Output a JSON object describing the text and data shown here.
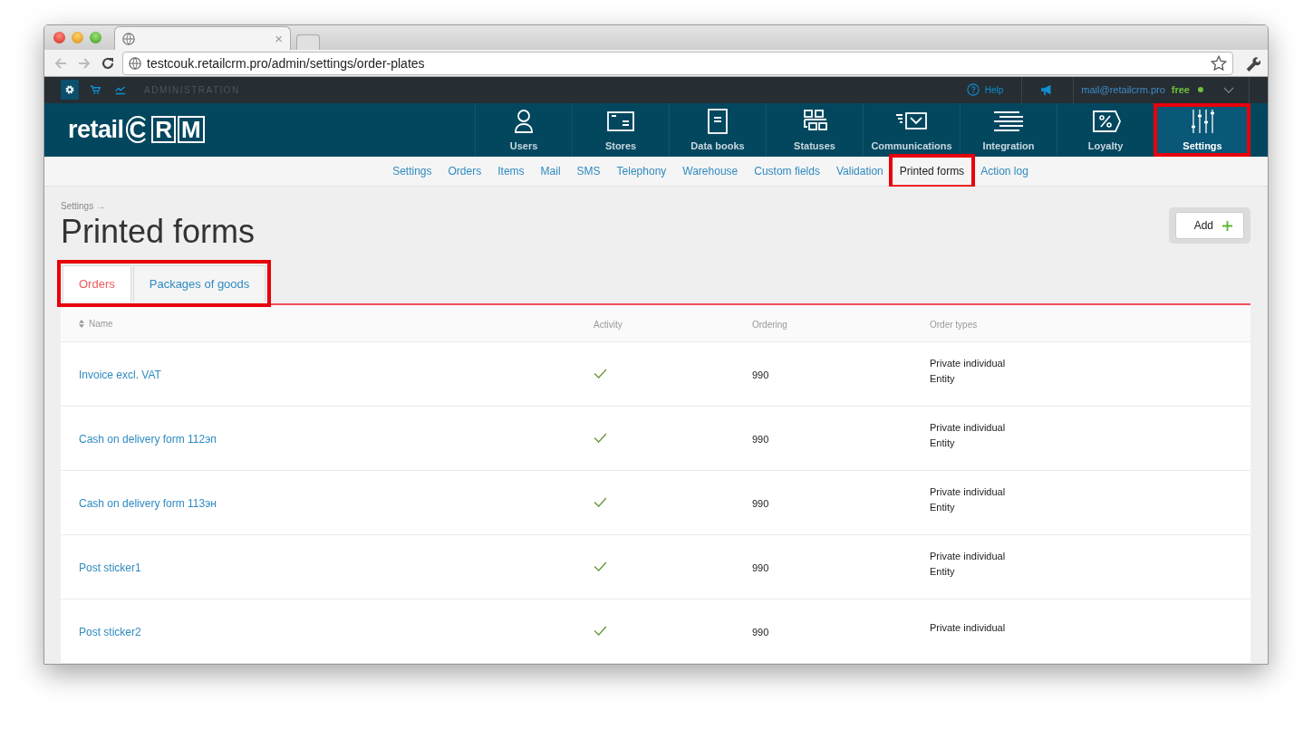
{
  "browser": {
    "tab_close": "×",
    "url": "testcouk.retailcrm.pro/admin/settings/order-plates"
  },
  "admin_bar": {
    "icons": [
      {
        "kind": "gear",
        "selected": true
      },
      {
        "kind": "cart",
        "selected": false
      },
      {
        "kind": "chart",
        "selected": false
      }
    ],
    "label": "ADMINISTRATION",
    "help": "Help",
    "email": "mail@retailcrm.pro",
    "plan": "free"
  },
  "logo": {
    "word": "retail",
    "letters": [
      "C",
      "R",
      "M"
    ]
  },
  "main_nav": [
    {
      "label": "Users",
      "kind": "user",
      "selected": false,
      "highlighted": false
    },
    {
      "label": "Stores",
      "kind": "store",
      "selected": false,
      "highlighted": false
    },
    {
      "label": "Data books",
      "kind": "book",
      "selected": false,
      "highlighted": false
    },
    {
      "label": "Statuses",
      "kind": "statuses",
      "selected": false,
      "highlighted": false
    },
    {
      "label": "Communications",
      "kind": "mail",
      "selected": false,
      "highlighted": false
    },
    {
      "label": "Integration",
      "kind": "lines",
      "selected": false,
      "highlighted": false
    },
    {
      "label": "Loyalty",
      "kind": "percent",
      "selected": false,
      "highlighted": false
    },
    {
      "label": "Settings",
      "kind": "sliders",
      "selected": true,
      "highlighted": true
    }
  ],
  "sub_nav": [
    {
      "label": "Settings",
      "selected": false,
      "highlighted": false
    },
    {
      "label": "Orders",
      "selected": false,
      "highlighted": false
    },
    {
      "label": "Items",
      "selected": false,
      "highlighted": false
    },
    {
      "label": "Mail",
      "selected": false,
      "highlighted": false
    },
    {
      "label": "SMS",
      "selected": false,
      "highlighted": false
    },
    {
      "label": "Telephony",
      "selected": false,
      "highlighted": false
    },
    {
      "label": "Warehouse",
      "selected": false,
      "highlighted": false
    },
    {
      "label": "Custom fields",
      "selected": false,
      "highlighted": false
    },
    {
      "label": "Validation",
      "selected": false,
      "highlighted": false
    },
    {
      "label": "Printed forms",
      "selected": true,
      "highlighted": true
    },
    {
      "label": "Action log",
      "selected": false,
      "highlighted": false
    }
  ],
  "breadcrumb": "Settings →",
  "title": "Printed forms",
  "add_button": "Add",
  "tabs": {
    "highlighted": true,
    "items": [
      {
        "label": "Orders",
        "selected": true
      },
      {
        "label": "Packages of goods",
        "selected": false
      }
    ]
  },
  "table": {
    "columns": [
      {
        "label": "Name",
        "sortable": true
      },
      {
        "label": "Activity",
        "sortable": false
      },
      {
        "label": "Ordering",
        "sortable": false
      },
      {
        "label": "Order types",
        "sortable": false
      }
    ],
    "rows": [
      {
        "name": "Invoice excl. VAT",
        "active": true,
        "ordering": "990",
        "order_types": [
          "Private individual",
          "Entity"
        ]
      },
      {
        "name": "Cash on delivery form 112эп",
        "active": true,
        "ordering": "990",
        "order_types": [
          "Private individual",
          "Entity"
        ]
      },
      {
        "name": "Cash on delivery form 113эн",
        "active": true,
        "ordering": "990",
        "order_types": [
          "Private individual",
          "Entity"
        ]
      },
      {
        "name": "Post sticker1",
        "active": true,
        "ordering": "990",
        "order_types": [
          "Private individual",
          "Entity"
        ]
      },
      {
        "name": "Post sticker2",
        "active": true,
        "ordering": "990",
        "order_types": [
          "Private individual"
        ]
      }
    ]
  }
}
